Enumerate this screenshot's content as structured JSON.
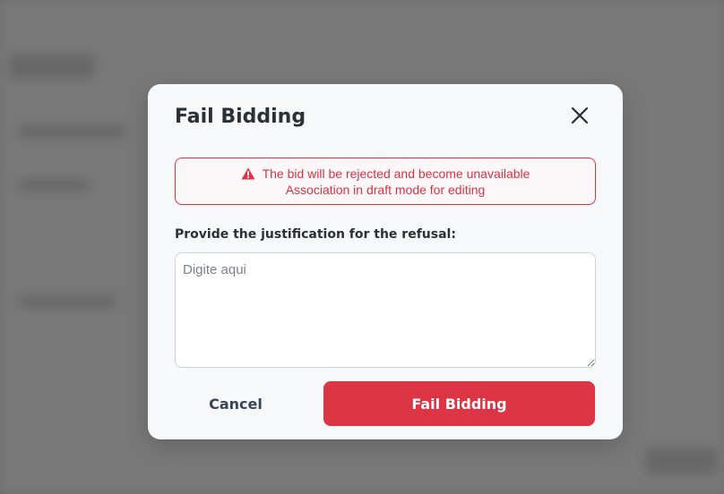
{
  "modal": {
    "title": "Fail Bidding",
    "alert": {
      "line1": "The bid will be rejected and become unavailable",
      "line2": "Association in draft mode for editing",
      "color": "#dc3545"
    },
    "justification": {
      "label": "Provide the justification for the refusal:",
      "placeholder": "Digite aqui",
      "value": ""
    },
    "actions": {
      "cancel_label": "Cancel",
      "confirm_label": "Fail Bidding"
    }
  },
  "colors": {
    "accent": "#dc3545",
    "text": "#2b2f36",
    "modal_bg": "#f7f8fa"
  },
  "icons": {
    "alert": "warning-triangle-icon",
    "close": "close-icon"
  }
}
